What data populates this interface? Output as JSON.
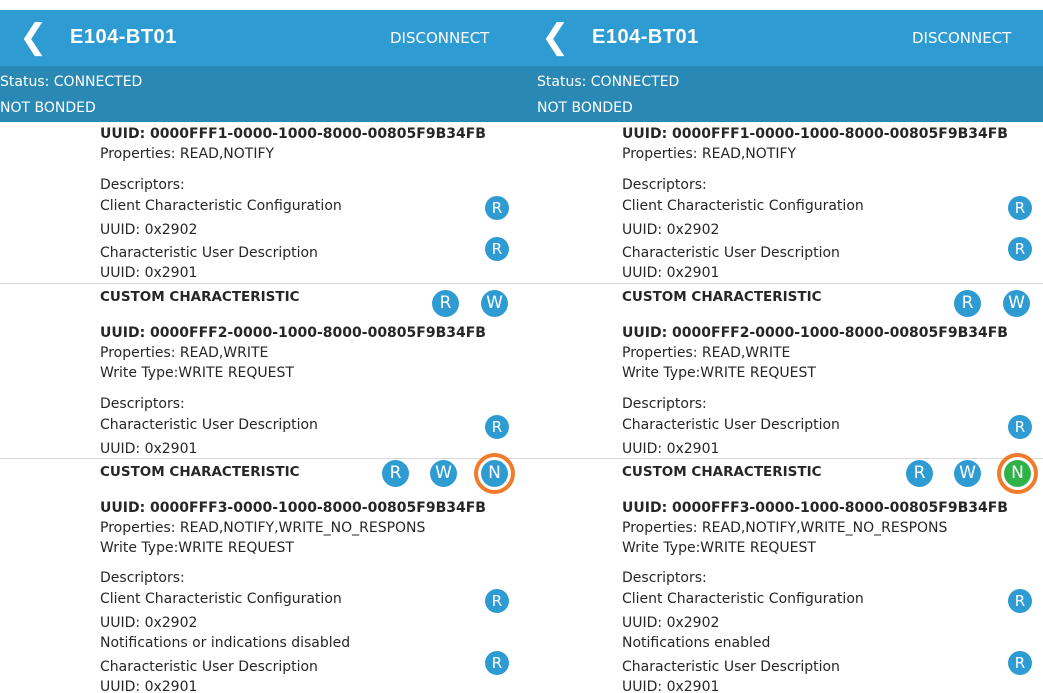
{
  "panes": [
    {
      "back_glyph": "❮",
      "device_name": "E104-BT01",
      "disconnect_label": "DISCONNECT",
      "status": "Status: CONNECTED",
      "bond": "NOT BONDED",
      "char1": {
        "uuid": "UUID: 0000FFF1-0000-1000-8000-00805F9B34FB",
        "properties": "Properties: READ,NOTIFY",
        "descriptors_label": "Descriptors:",
        "desc1_name": "Client Characteristic Configuration",
        "desc1_uuid": "UUID: 0x2902",
        "desc2_name": "Characteristic User Description",
        "desc2_uuid": "UUID: 0x2901"
      },
      "char2": {
        "title": "CUSTOM CHARACTERISTIC",
        "uuid": "UUID: 0000FFF2-0000-1000-8000-00805F9B34FB",
        "properties": "Properties: READ,WRITE",
        "write_type": "Write Type:WRITE REQUEST",
        "descriptors_label": "Descriptors:",
        "desc1_name": "Characteristic User Description",
        "desc1_uuid": "UUID: 0x2901"
      },
      "char3": {
        "title": "CUSTOM CHARACTERISTIC",
        "uuid": "UUID: 0000FFF3-0000-1000-8000-00805F9B34FB",
        "properties": "Properties: READ,NOTIFY,WRITE_NO_RESPONS",
        "write_type": "Write Type:WRITE REQUEST",
        "descriptors_label": "Descriptors:",
        "desc1_name": "Client Characteristic Configuration",
        "desc1_uuid": "UUID: 0x2902",
        "notification_status": "Notifications or indications disabled",
        "desc2_name": "Characteristic User Description",
        "desc2_uuid": "UUID: 0x2901"
      }
    },
    {
      "back_glyph": "❮",
      "device_name": "E104-BT01",
      "disconnect_label": "DISCONNECT",
      "status": "Status: CONNECTED",
      "bond": "NOT BONDED",
      "char1": {
        "uuid": "UUID: 0000FFF1-0000-1000-8000-00805F9B34FB",
        "properties": "Properties: READ,NOTIFY",
        "descriptors_label": "Descriptors:",
        "desc1_name": "Client Characteristic Configuration",
        "desc1_uuid": "UUID: 0x2902",
        "desc2_name": "Characteristic User Description",
        "desc2_uuid": "UUID: 0x2901"
      },
      "char2": {
        "title": "CUSTOM CHARACTERISTIC",
        "uuid": "UUID: 0000FFF2-0000-1000-8000-00805F9B34FB",
        "properties": "Properties: READ,WRITE",
        "write_type": "Write Type:WRITE REQUEST",
        "descriptors_label": "Descriptors:",
        "desc1_name": "Characteristic User Description",
        "desc1_uuid": "UUID: 0x2901"
      },
      "char3": {
        "title": "CUSTOM CHARACTERISTIC",
        "uuid": "UUID: 0000FFF3-0000-1000-8000-00805F9B34FB",
        "properties": "Properties: READ,NOTIFY,WRITE_NO_RESPONS",
        "write_type": "Write Type:WRITE REQUEST",
        "descriptors_label": "Descriptors:",
        "desc1_name": "Client Characteristic Configuration",
        "desc1_uuid": "UUID: 0x2902",
        "notification_status": "Notifications enabled",
        "desc2_name": "Characteristic User Description",
        "desc2_uuid": "UUID: 0x2901"
      }
    }
  ],
  "buttons": {
    "read": "R",
    "write": "W",
    "notify": "N"
  },
  "colors": {
    "app_bar": "#2f9bd3",
    "status_bar": "#2a88b4",
    "button_blue": "#2f9bd3",
    "notify_active_green": "#2fb24a",
    "highlight_ring_orange": "#f07b2c"
  }
}
